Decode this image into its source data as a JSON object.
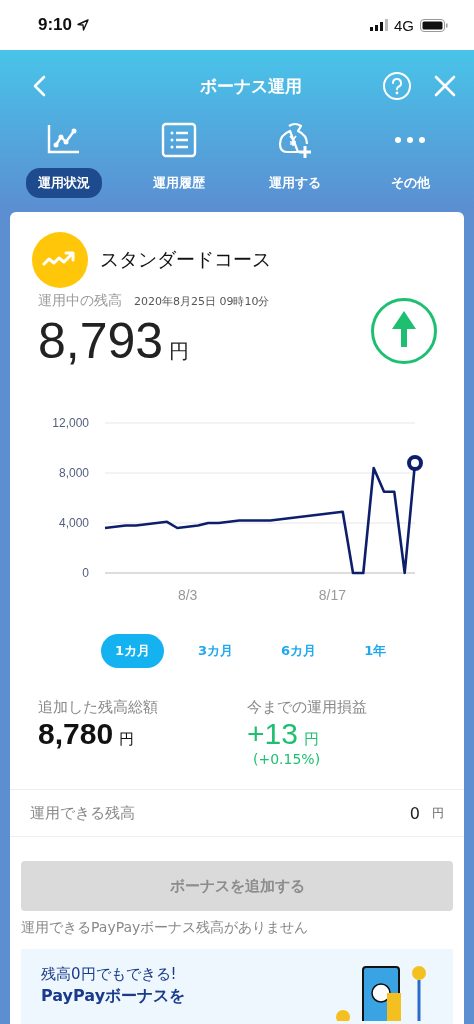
{
  "status_bar": {
    "time": "9:10",
    "network": "4G"
  },
  "header": {
    "title": "ボーナス運用"
  },
  "tabs": [
    {
      "label": "運用状況",
      "selected": true
    },
    {
      "label": "運用履歴",
      "selected": false
    },
    {
      "label": "運用する",
      "selected": false
    },
    {
      "label": "その他",
      "selected": false
    }
  ],
  "course": {
    "name": "スタンダードコース",
    "balance_label": "運用中の残高",
    "timestamp": "2020年8月25日 09時10分",
    "amount": "8,793",
    "unit": "円"
  },
  "chart_data": {
    "type": "line",
    "categories": [
      null,
      null,
      null,
      null,
      null,
      null,
      null,
      null,
      "8/3",
      null,
      null,
      null,
      null,
      null,
      null,
      null,
      null,
      null,
      null,
      null,
      null,
      null,
      "8/17",
      null,
      null,
      null,
      null,
      null,
      null,
      null,
      null
    ],
    "ylim": [
      0,
      12000
    ],
    "yticks": [
      {
        "value": 0,
        "label": "0"
      },
      {
        "value": 4000,
        "label": "4,000"
      },
      {
        "value": 8000,
        "label": "8,000"
      },
      {
        "value": 12000,
        "label": "12,000"
      }
    ],
    "series": [
      {
        "color": "#0d1f6b",
        "values": [
          3600,
          3700,
          3800,
          3800,
          3900,
          4000,
          4100,
          3600,
          3700,
          3800,
          4000,
          4000,
          4100,
          4200,
          4200,
          4200,
          4200,
          4300,
          4400,
          4500,
          4600,
          4700,
          4800,
          4900,
          0,
          0,
          8400,
          6500,
          6500,
          0,
          8800
        ]
      }
    ]
  },
  "periods": [
    {
      "label": "1カ月",
      "selected": true
    },
    {
      "label": "3カ月",
      "selected": false
    },
    {
      "label": "6カ月",
      "selected": false
    },
    {
      "label": "1年",
      "selected": false
    }
  ],
  "summary": [
    {
      "label": "追加した残高総額",
      "amount": "8,780",
      "unit": "円",
      "kind": "plain"
    },
    {
      "label": "今までの運用損益",
      "amount": "+13",
      "unit": "円",
      "percent": "(+0.15%)",
      "kind": "gain"
    }
  ],
  "available": {
    "label": "運用できる残高",
    "amount": "0",
    "unit": "円"
  },
  "add_button": {
    "label": "ボーナスを追加する",
    "disabled": true
  },
  "notice": "運用できるPayPayボーナス残高がありません",
  "banner": {
    "subtitle": "残高0円でもできる!",
    "title": "PayPayボーナスを"
  }
}
